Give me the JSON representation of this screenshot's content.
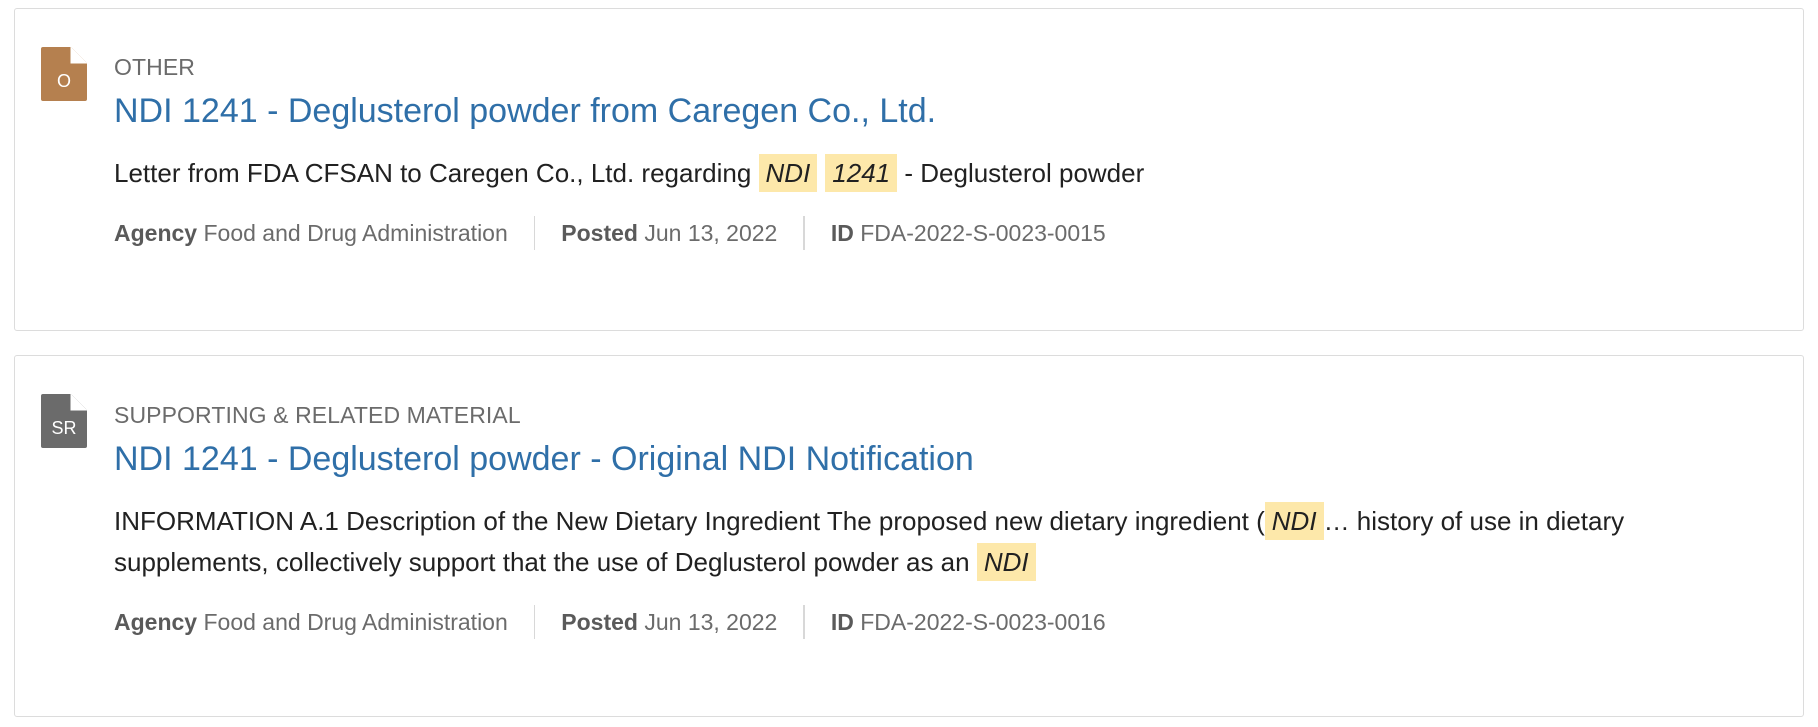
{
  "colors": {
    "title_link": "#2f6fa8",
    "highlight": "#fde8aa",
    "icon_other": "#b5804f",
    "icon_supporting": "#6b6b6b"
  },
  "results": [
    {
      "icon": {
        "name": "document-other-icon",
        "letter": "O"
      },
      "doc_type": "OTHER",
      "title": "NDI 1241 - Deglusterol powder from Caregen Co., Ltd.",
      "snippet": {
        "t1": "Letter from FDA CFSAN to Caregen Co., Ltd. regarding ",
        "hl1": "NDI",
        "hl2": "1241",
        "t2": " - Deglusterol powder"
      },
      "meta": {
        "agency_label": "Agency",
        "agency_value": "Food and Drug Administration",
        "posted_label": "Posted",
        "posted_value": "Jun 13, 2022",
        "id_label": "ID",
        "id_value": "FDA-2022-S-0023-0015"
      }
    },
    {
      "icon": {
        "name": "document-supporting-icon",
        "letter": "SR"
      },
      "doc_type": "SUPPORTING & RELATED MATERIAL",
      "title": "NDI 1241 - Deglusterol powder - Original NDI Notification",
      "snippet": {
        "t1": "INFORMATION A.1 Description of the New Dietary Ingredient The proposed new dietary ingredient (",
        "hl1": "NDI",
        "t2": "… history of use in dietary supplements, collectively support that the use of Deglusterol powder as an ",
        "hl2": "NDI"
      },
      "meta": {
        "agency_label": "Agency",
        "agency_value": "Food and Drug Administration",
        "posted_label": "Posted",
        "posted_value": "Jun 13, 2022",
        "id_label": "ID",
        "id_value": "FDA-2022-S-0023-0016"
      }
    }
  ]
}
